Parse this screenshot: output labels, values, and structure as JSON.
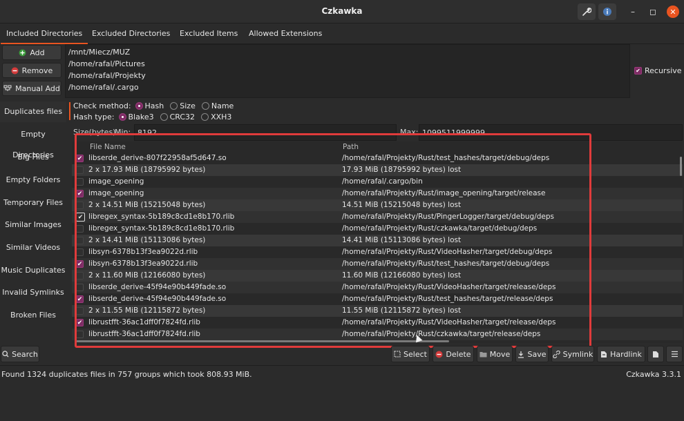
{
  "window": {
    "title": "Czkawka"
  },
  "tabs": [
    {
      "label": "Included Directories",
      "active": true
    },
    {
      "label": "Excluded Directories",
      "active": false
    },
    {
      "label": "Excluded Items",
      "active": false
    },
    {
      "label": "Allowed Extensions",
      "active": false
    }
  ],
  "directory_buttons": {
    "add": "Add",
    "remove": "Remove",
    "manual_add": "Manual Add"
  },
  "directories": [
    "/mnt/Miecz/MUZ",
    "/home/rafal/Pictures",
    "/home/rafal/Projekty",
    "/home/rafal/.cargo"
  ],
  "recursive": {
    "label": "Recursive",
    "checked": true
  },
  "sidebar": {
    "items": [
      {
        "label": "Duplicates files",
        "active": true
      },
      {
        "label": "Empty Directories"
      },
      {
        "label": "Big Files"
      },
      {
        "label": "Empty Folders"
      },
      {
        "label": "Temporary Files"
      },
      {
        "label": "Similar Images"
      },
      {
        "label": "Similar Videos"
      },
      {
        "label": "Music Duplicates"
      },
      {
        "label": "Invalid Symlinks"
      },
      {
        "label": "Broken Files"
      }
    ]
  },
  "options": {
    "check_method_label": "Check method:",
    "check_methods": [
      {
        "label": "Hash",
        "selected": true
      },
      {
        "label": "Size",
        "selected": false
      },
      {
        "label": "Name",
        "selected": false
      }
    ],
    "hash_type_label": "Hash type:",
    "hash_types": [
      {
        "label": "Blake3",
        "selected": true
      },
      {
        "label": "CRC32",
        "selected": false
      },
      {
        "label": "XXH3",
        "selected": false
      }
    ],
    "size_label": "Size(bytes)",
    "min_label": "Min:",
    "min_value": "8192",
    "max_label": "Max:",
    "max_value": "1099511999999"
  },
  "results": {
    "columns": {
      "file_name": "File Name",
      "path": "Path"
    },
    "rows": [
      {
        "type": "file",
        "checked": true,
        "name": "libserde_derive-807f22958af5d647.so",
        "path": "/home/rafal/Projekty/Rust/test_hashes/target/debug/deps"
      },
      {
        "type": "header",
        "name": "2 x 17.93 MiB (18795992 bytes)",
        "path": "17.93 MiB (18795992 bytes) lost"
      },
      {
        "type": "file",
        "checked": false,
        "name": "image_opening",
        "path": "/home/rafal/.cargo/bin"
      },
      {
        "type": "file",
        "checked": true,
        "name": "image_opening",
        "path": "/home/rafal/Projekty/Rust/image_opening/target/release"
      },
      {
        "type": "header",
        "name": "2 x 14.51 MiB (15215048 bytes)",
        "path": "14.51 MiB (15215048 bytes) lost"
      },
      {
        "type": "file",
        "checked": true,
        "highlight": true,
        "name": "libregex_syntax-5b189c8cd1e8b170.rlib",
        "path": "/home/rafal/Projekty/Rust/PingerLogger/target/debug/deps"
      },
      {
        "type": "file",
        "checked": false,
        "name": "libregex_syntax-5b189c8cd1e8b170.rlib",
        "path": "/home/rafal/Projekty/Rust/czkawka/target/debug/deps"
      },
      {
        "type": "header",
        "name": "2 x 14.41 MiB (15113086 bytes)",
        "path": "14.41 MiB (15113086 bytes) lost"
      },
      {
        "type": "file",
        "checked": false,
        "name": "libsyn-6378b13f3ea9022d.rlib",
        "path": "/home/rafal/Projekty/Rust/VideoHasher/target/debug/deps"
      },
      {
        "type": "file",
        "checked": true,
        "name": "libsyn-6378b13f3ea9022d.rlib",
        "path": "/home/rafal/Projekty/Rust/test_hashes/target/debug/deps"
      },
      {
        "type": "header",
        "name": "2 x 11.60 MiB (12166080 bytes)",
        "path": "11.60 MiB (12166080 bytes) lost"
      },
      {
        "type": "file",
        "checked": false,
        "name": "libserde_derive-45f94e90b449fade.so",
        "path": "/home/rafal/Projekty/Rust/VideoHasher/target/release/deps"
      },
      {
        "type": "file",
        "checked": true,
        "name": "libserde_derive-45f94e90b449fade.so",
        "path": "/home/rafal/Projekty/Rust/test_hashes/target/release/deps"
      },
      {
        "type": "header",
        "name": "2 x 11.55 MiB (12115872 bytes)",
        "path": "11.55 MiB (12115872 bytes) lost"
      },
      {
        "type": "file",
        "checked": true,
        "name": "librustfft-36ac1dff0f7824fd.rlib",
        "path": "/home/rafal/Projekty/Rust/VideoHasher/target/release/deps"
      },
      {
        "type": "file",
        "checked": false,
        "name": "librustfft-36ac1dff0f7824fd.rlib",
        "path": "/home/rafal/Projekty/Rust/czkawka/target/release/deps"
      }
    ]
  },
  "bottom_buttons": {
    "search": "Search",
    "select": "Select",
    "delete": "Delete",
    "move": "Move",
    "save": "Save",
    "symlink": "Symlink",
    "hardlink": "Hardlink"
  },
  "status": {
    "message": "Found 1324 duplicates files in 757 groups which took 808.93 MiB.",
    "version": "Czkawka 3.3.1"
  },
  "colors": {
    "accent": "#e95420",
    "check": "#7e2c64",
    "highlight_frame": "#e03b3b"
  }
}
